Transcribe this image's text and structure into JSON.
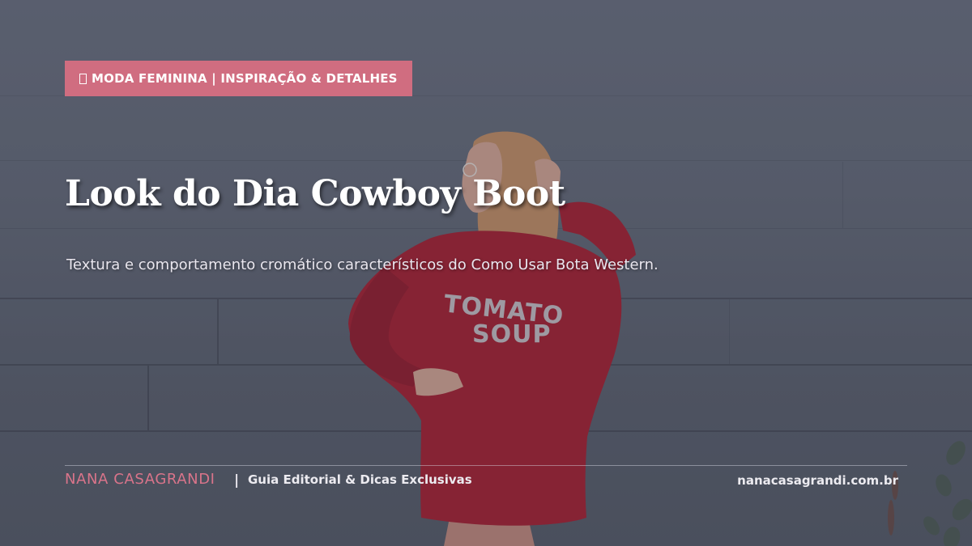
{
  "badge": {
    "label": "MODA FEMININA | INSPIRAÇÃO & DETALHES",
    "icon": "tag-icon",
    "color": "#d06d80"
  },
  "headline": {
    "title": "Look do Dia Cowboy Boot",
    "subtitle": "Textura e comportamento cromático característicos do Como Usar Bota Western."
  },
  "footer": {
    "brand": "NANA CASAGRANDI",
    "separator": "|",
    "tagline": "Guia Editorial & Dicas Exclusivas",
    "url": "nanacasagrandi.com.br",
    "brand_color": "#d9748a"
  },
  "photo": {
    "sweater_text_line1": "TOMATO",
    "sweater_text_line2": "SOUP",
    "sweater_color": "#a81e30"
  }
}
